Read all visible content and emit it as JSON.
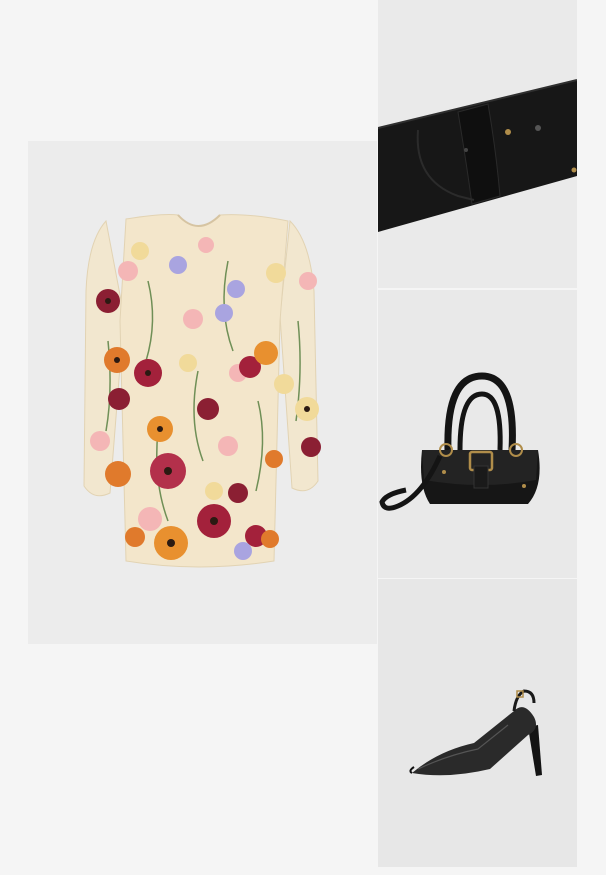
{
  "products": [
    {
      "item": "floral-embroidered-mini-dress",
      "icon": "dress-icon"
    },
    {
      "item": "black-leather-belt",
      "icon": "belt-icon"
    },
    {
      "item": "black-leather-shoulder-bag",
      "icon": "handbag-icon"
    },
    {
      "item": "black-metallic-slingback-pump",
      "icon": "shoe-icon"
    }
  ],
  "colors": {
    "page_bg": "#f5f5f5",
    "tile_bg": "#ebebeb",
    "dress_base": "#f1e4c8",
    "accessory": "#1a1a1a",
    "hardware_gold": "#b08d4a"
  }
}
